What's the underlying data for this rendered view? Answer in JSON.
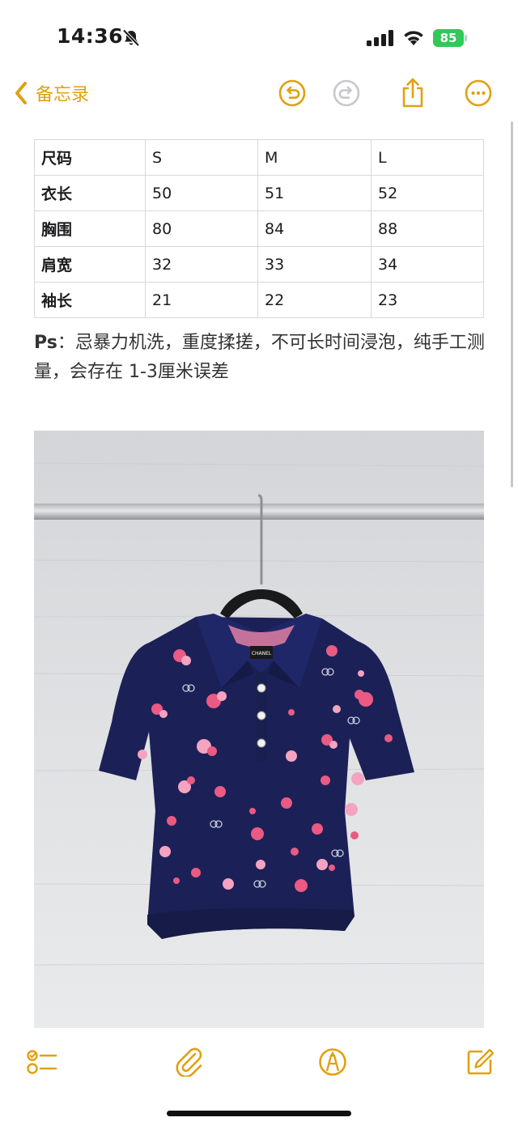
{
  "status_bar": {
    "time": "14:36",
    "battery": "85"
  },
  "nav": {
    "back_label": "备忘录"
  },
  "size_table": {
    "rows": [
      [
        "尺码",
        "S",
        "M",
        "L"
      ],
      [
        "衣长",
        "50",
        "51",
        "52"
      ],
      [
        "胸围",
        "80",
        "84",
        "88"
      ],
      [
        "肩宽",
        "32",
        "33",
        "34"
      ],
      [
        "袖长",
        "21",
        "22",
        "23"
      ]
    ]
  },
  "note": {
    "prefix": "Ps",
    "text": "：忌暴力机洗，重度揉搓，不可长时间浸泡，纯手工测量，会存在 1-3厘米误差"
  },
  "photo": {
    "label_text": "CHANEL"
  },
  "colors": {
    "accent": "#e0a110",
    "shirt": "#1b2157",
    "flower": "#ea5a82"
  },
  "icons": {
    "back": "chevron-left-icon",
    "undo": "undo-icon",
    "redo": "redo-icon",
    "share": "share-icon",
    "more": "more-icon",
    "checklist": "checklist-icon",
    "attach": "paperclip-icon",
    "markup": "markup-pen-icon",
    "compose": "compose-icon"
  }
}
